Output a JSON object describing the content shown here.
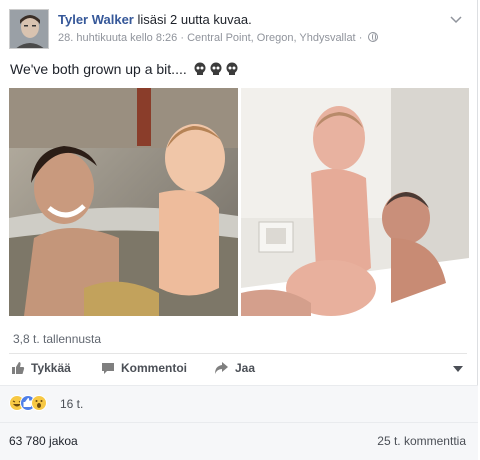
{
  "header": {
    "author": "Tyler Walker",
    "action": "lisäsi 2 uutta kuvaa.",
    "timestamp": "28. huhtikuuta kello 8:26",
    "separator": "·",
    "location": "Central Point, Oregon, Yhdysvallat",
    "separator2": "·",
    "privacy_icon": "globe-icon",
    "options_icon": "chevron-down-icon"
  },
  "post": {
    "text": "We've both grown up a bit....",
    "emoji": [
      "skull-icon",
      "skull-icon",
      "skull-icon"
    ]
  },
  "photos": [
    {
      "name": "photo-left"
    },
    {
      "name": "photo-right"
    }
  ],
  "stats": {
    "shares_small": "3,8 t. tallennusta",
    "reaction_count": "16 t.",
    "reaction_icons": [
      "haha-icon",
      "like-icon",
      "wow-icon"
    ],
    "shares": "63 780 jakoa",
    "comments": "25 t. kommenttia"
  },
  "actions": {
    "like": "Tykkää",
    "comment": "Kommentoi",
    "share": "Jaa"
  },
  "colors": {
    "link": "#365899",
    "text": "#1d2129",
    "muted": "#90949c",
    "like_blue": "#4f7fe8",
    "haha_yellow": "#f7c844"
  }
}
